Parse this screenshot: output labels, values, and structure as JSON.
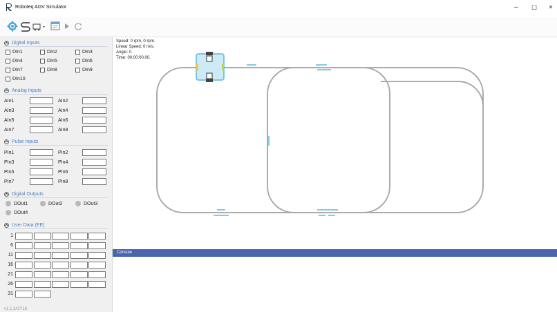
{
  "window": {
    "title": "Roboteq AGV Simulator",
    "minimize": "–",
    "maximize": "☐",
    "close": "✕"
  },
  "colors": {
    "accent": "#4a7fc1",
    "console_header": "#4a64ad",
    "track": "#ababab",
    "marker": "#5bb8d8",
    "robot_fill": "#cdeaf7"
  },
  "toolbar": {
    "icons": [
      "settings-gear-icon",
      "track-path-icon",
      "agv-dropdown-icon",
      "panel-icon",
      "play-icon",
      "refresh-icon"
    ]
  },
  "digital_inputs": {
    "title": "Digital Inputs",
    "items": [
      "DIn1",
      "DIn2",
      "DIn3",
      "DIn4",
      "DIn5",
      "DIn6",
      "DIn7",
      "DIn8",
      "DIn9",
      "DIn10"
    ]
  },
  "analog_inputs": {
    "title": "Analog Inputs",
    "items": [
      "AIn1",
      "AIn2",
      "AIn3",
      "AIn4",
      "AIn5",
      "AIn6",
      "AIn7",
      "AIn8"
    ]
  },
  "pulse_inputs": {
    "title": "Pulse Inputs",
    "items": [
      "PIn1",
      "PIn2",
      "PIn3",
      "PIn4",
      "PIn5",
      "PIn6",
      "PIn7",
      "PIn8"
    ]
  },
  "digital_outputs": {
    "title": "Digital Outputs",
    "items": [
      "DOut1",
      "DOut2",
      "DOut3",
      "DOut4"
    ]
  },
  "user_data": {
    "title": "User Data (EE)",
    "rows": [
      "1",
      "6",
      "11",
      "16",
      "21",
      "26",
      "31"
    ]
  },
  "version": "v1.1.2/07/18",
  "status": {
    "speed": "Speed: 0 rpm, 0 rpm.",
    "linear_speed": "Linear Speed: 0 m/s.",
    "angle": "Angle: 0.",
    "time": "Time: 00:00:00.00."
  },
  "console": {
    "title": "Console"
  }
}
